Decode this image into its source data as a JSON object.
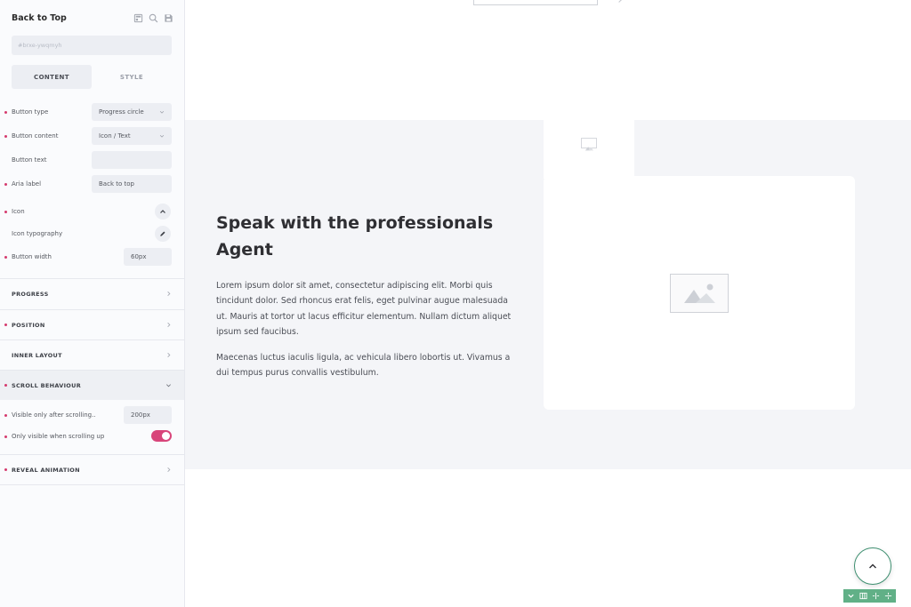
{
  "sidebar": {
    "title": "Back to Top",
    "header_icons": [
      "template-icon",
      "search-icon",
      "save-icon"
    ],
    "element_id": "#brxe-ywqmyh",
    "tabs": [
      {
        "label": "CONTENT",
        "active": true
      },
      {
        "label": "STYLE",
        "active": false
      }
    ],
    "controls": {
      "button_type": {
        "label": "Button type",
        "value": "Progress circle"
      },
      "button_content": {
        "label": "Button content",
        "value": "Icon / Text"
      },
      "button_text": {
        "label": "Button text",
        "value": ""
      },
      "aria_label": {
        "label": "Aria label",
        "value": "Back to top"
      },
      "icon": {
        "label": "Icon"
      },
      "icon_typography": {
        "label": "Icon typography"
      },
      "button_width": {
        "label": "Button width",
        "value": "60px"
      }
    },
    "sections": [
      {
        "label": "PROGRESS",
        "open": false
      },
      {
        "label": "POSITION",
        "open": false
      },
      {
        "label": "INNER LAYOUT",
        "open": false
      },
      {
        "label": "SCROLL BEHAVIOUR",
        "open": true
      },
      {
        "label": "REVEAL ANIMATION",
        "open": false
      }
    ],
    "scroll": {
      "visible_after": {
        "label": "Visible only after scrolling..",
        "value": "200px"
      },
      "visible_scroll_up": {
        "label": "Only visible when scrolling up",
        "enabled": true
      }
    }
  },
  "canvas": {
    "heading": "Speak with the professionals Agent",
    "paragraph1": "Lorem ipsum dolor sit amet, consectetur adipiscing elit. Morbi quis tincidunt dolor. Sed rhoncus erat felis, eget pulvinar augue malesuada ut. Mauris at tortor ut lacus efficitur elementum. Nullam dictum aliquet ipsum sed faucibus.",
    "paragraph2": "Maecenas luctus iaculis ligula, ac vehicula libero lobortis ut. Vivamus a dui tempus purus convallis vestibulum."
  },
  "colors": {
    "accent_pink": "#d8457a",
    "accent_green": "#61b087",
    "band_bg": "#f4f5f8"
  }
}
